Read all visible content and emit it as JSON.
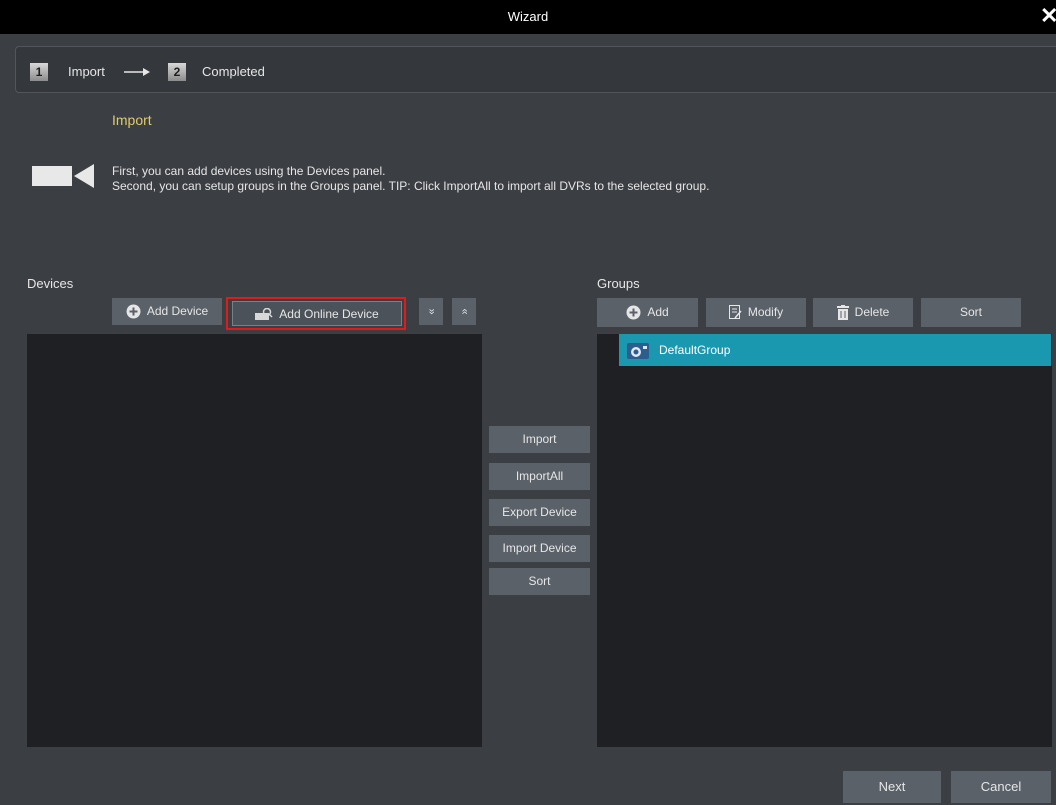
{
  "window": {
    "title": "Wizard",
    "close_glyph": "✕"
  },
  "steps": [
    {
      "number": "1",
      "label": "Import"
    },
    {
      "number": "2",
      "label": "Completed"
    }
  ],
  "section_title": "Import",
  "info": {
    "line1": "First, you can add devices using the Devices panel.",
    "line2": "Second, you can setup groups in the Groups panel. TIP: Click ImportAll to import all DVRs to the selected group."
  },
  "devices": {
    "label": "Devices",
    "add_device": "Add Device",
    "add_online_device": "Add Online Device",
    "expand_glyph": "»",
    "collapse_glyph": "«"
  },
  "transfer_buttons": {
    "import": "Import",
    "import_all": "ImportAll",
    "export_device": "Export Device",
    "import_device": "Import Device",
    "sort": "Sort"
  },
  "groups": {
    "label": "Groups",
    "add": "Add",
    "modify": "Modify",
    "delete": "Delete",
    "sort": "Sort",
    "items": [
      {
        "name": "DefaultGroup",
        "selected": true
      }
    ]
  },
  "footer": {
    "next": "Next",
    "cancel": "Cancel"
  },
  "colors": {
    "accent_selected": "#1a98b0",
    "highlight_border": "#e01b1b",
    "section_title": "#e3c96a"
  }
}
